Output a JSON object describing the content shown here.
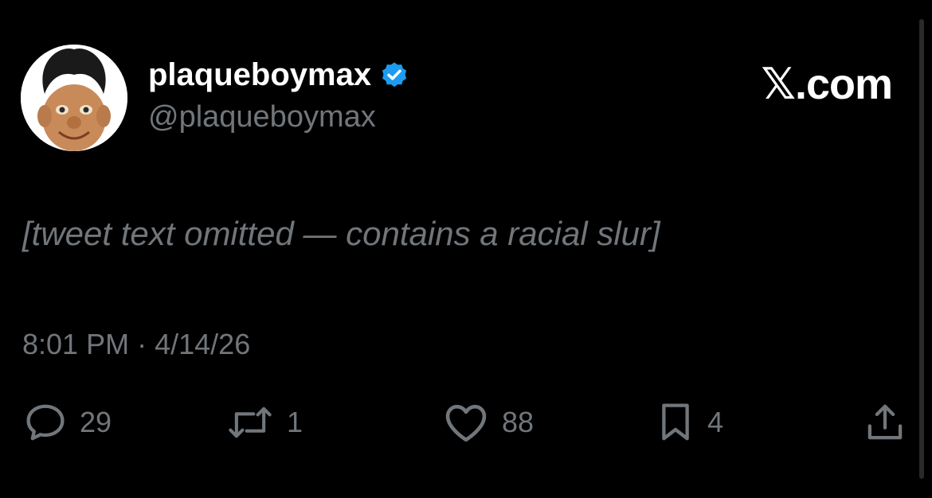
{
  "author": {
    "display_name": "plaqueboymax",
    "handle": "@plaqueboymax",
    "verified": true
  },
  "brand": {
    "site_label": "𝕏.com"
  },
  "tweet": {
    "text": "[tweet text omitted — contains a racial slur]",
    "time": "8:01 PM",
    "separator": "·",
    "date": "4/14/26"
  },
  "actions": {
    "replies": "29",
    "reposts": "1",
    "likes": "88",
    "bookmarks": "4"
  },
  "colors": {
    "background": "#000000",
    "text_primary": "#ffffff",
    "text_secondary": "#71767b",
    "verified_badge": "#1d9bf0"
  },
  "icons": [
    "reply-icon",
    "repost-icon",
    "like-icon",
    "bookmark-icon",
    "share-icon",
    "verified-badge-icon"
  ]
}
